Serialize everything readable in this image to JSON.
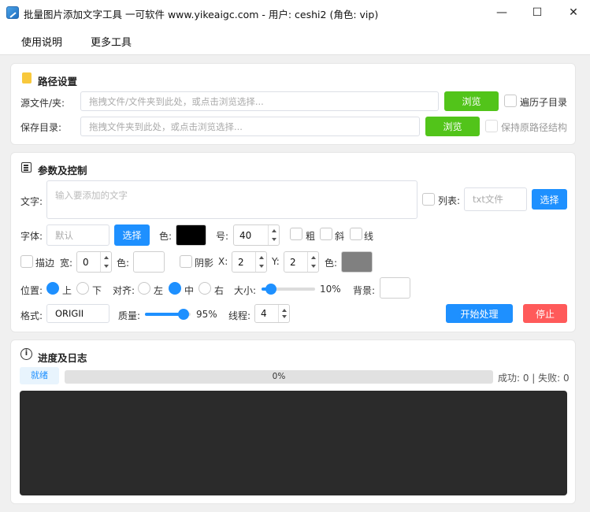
{
  "window": {
    "title": "批量图片添加文字工具 一可软件 www.yikeaigc.com - 用户: ceshi2 (角色: vip)",
    "minimize": "—",
    "maximize": "☐",
    "close": "✕"
  },
  "menu": {
    "help": "使用说明",
    "more_tools": "更多工具"
  },
  "path": {
    "title": "路径设置",
    "source_label": "源文件/夹:",
    "source_placeholder": "拖拽文件/文件夹到此处，或点击浏览选择...",
    "browse": "浏览",
    "recurse": "遍历子目录",
    "save_label": "保存目录:",
    "save_placeholder": "拖拽文件夹到此处，或点击浏览选择...",
    "keep_structure": "保持原路径结构"
  },
  "params": {
    "title": "参数及控制",
    "text_label": "文字:",
    "text_placeholder": "输入要添加的文字",
    "list_label": "列表:",
    "txt_placeholder": "txt文件",
    "select": "选择",
    "font_label": "字体:",
    "font_value": "默认",
    "color_label": "色:",
    "size_label": "号:",
    "size_value": "40",
    "bold": "粗",
    "italic": "斜",
    "underline": "线",
    "stroke": "描边",
    "width_label": "宽:",
    "stroke_width": "0",
    "shadow": "阴影",
    "x_label": "X:",
    "shadow_x": "2",
    "y_label": "Y:",
    "shadow_y": "2",
    "position_label": "位置:",
    "pos_top": "上",
    "pos_bottom": "下",
    "align_label": "对齐:",
    "align_left": "左",
    "align_center": "中",
    "align_right": "右",
    "scale_label": "大小:",
    "scale_value": "10%",
    "scale_fraction": 0.1,
    "bg_label": "背景:",
    "format_label": "格式:",
    "format_value": "ORIGII",
    "quality_label": "质量:",
    "quality_value": "95%",
    "quality_fraction": 0.95,
    "threads_label": "线程:",
    "threads_value": "4",
    "start": "开始处理",
    "stop": "停止",
    "colors": {
      "text": "#000000",
      "stroke": "#ffffff",
      "shadow": "#808080",
      "background": "#ffffff"
    }
  },
  "progress": {
    "title": "进度及日志",
    "status": "就绪",
    "percent": "0%",
    "fraction": 0,
    "stats": "成功: 0 | 失败: 0"
  }
}
